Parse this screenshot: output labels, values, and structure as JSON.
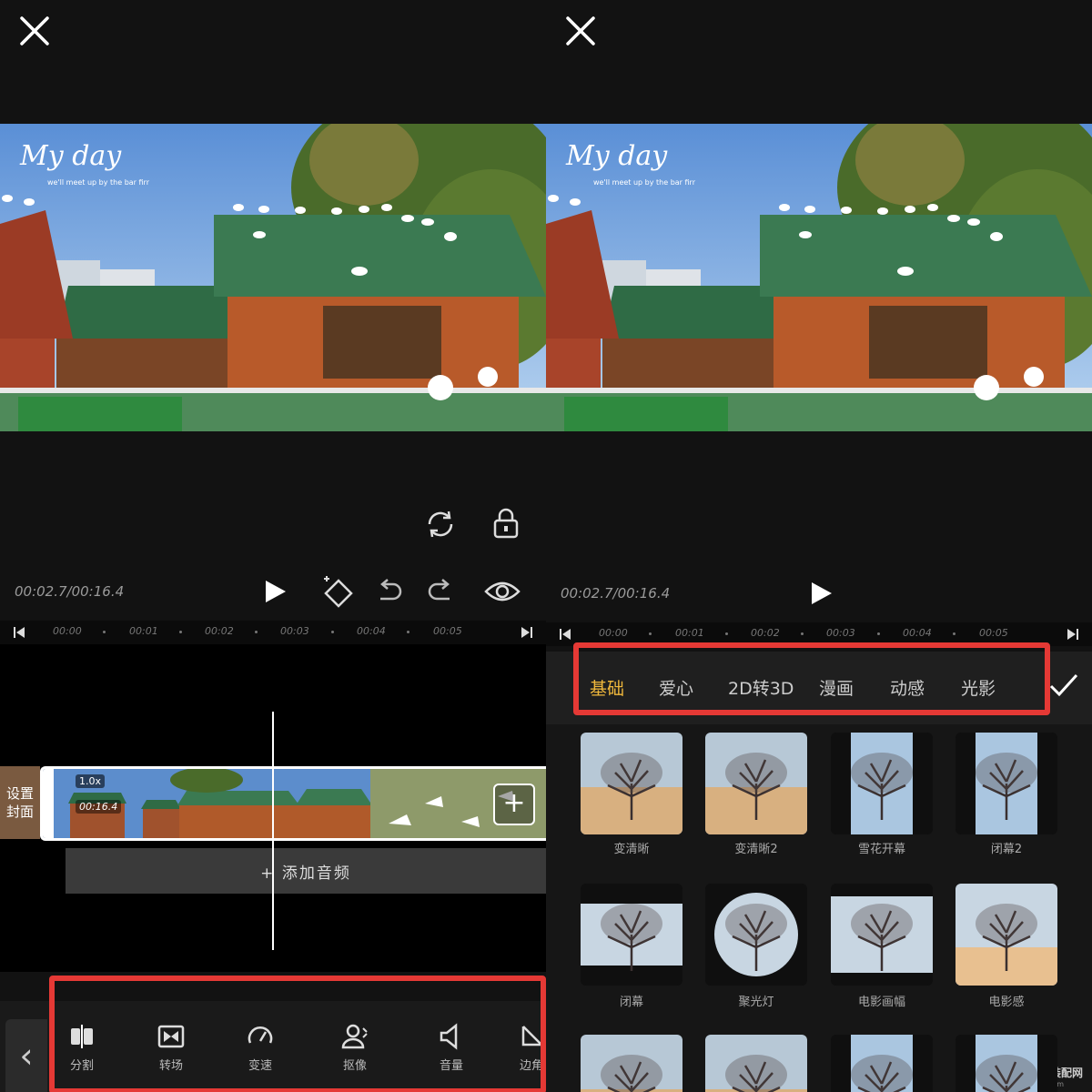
{
  "overlay": {
    "title": "My day",
    "subtitle": "we'll meet up by the bar firr"
  },
  "timecode": "00:02.7/00:16.4",
  "ruler_ticks": [
    "00:00",
    "00:01",
    "00:02",
    "00:03",
    "00:04",
    "00:05"
  ],
  "left": {
    "cover_label": [
      "设置",
      "封面"
    ],
    "clip_speed": "1.0x",
    "clip_duration": "00:16.4",
    "add_audio": "+ 添加音频",
    "tools": [
      {
        "label": "分割",
        "icon": "split-icon"
      },
      {
        "label": "转场",
        "icon": "transition-icon"
      },
      {
        "label": "变速",
        "icon": "speed-icon"
      },
      {
        "label": "抠像",
        "icon": "cutout-icon"
      },
      {
        "label": "音量",
        "icon": "volume-icon"
      },
      {
        "label": "边角",
        "icon": "corner-icon"
      }
    ]
  },
  "right": {
    "tabs": [
      "基础",
      "爱心",
      "2D转3D",
      "漫画",
      "动感",
      "光影"
    ],
    "active_tab": 0,
    "effects": [
      {
        "label": "变清晰"
      },
      {
        "label": "变清晰2"
      },
      {
        "label": "雪花开幕"
      },
      {
        "label": "闭幕2"
      },
      {
        "label": "闭幕"
      },
      {
        "label": "聚光灯"
      },
      {
        "label": "电影画幅"
      },
      {
        "label": "电影感"
      }
    ]
  },
  "watermark": {
    "name": "电脑装配网",
    "url": "dnzp.com"
  },
  "colors": {
    "accent": "#f0b83c",
    "highlight": "#e53935"
  }
}
